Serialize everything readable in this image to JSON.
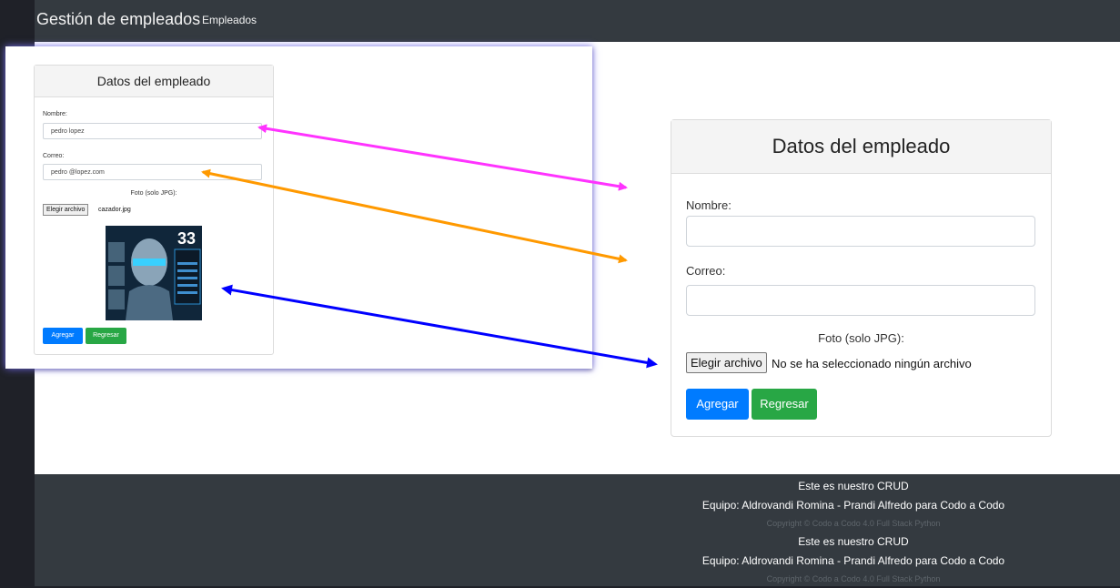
{
  "navbar": {
    "brand": "Gestión de empleados",
    "link": "Empleados"
  },
  "small_form": {
    "title": "Datos del empleado",
    "nombre_label": "Nombre:",
    "nombre_value": "pedro lopez",
    "correo_label": "Correo:",
    "correo_value": "pedro @lopez.com",
    "foto_label": "Foto (solo JPG):",
    "file_button": "Elegir archivo",
    "file_name": "cazador.jpg",
    "image_text": "33",
    "agregar": "Agregar",
    "regresar": "Regresar"
  },
  "big_form": {
    "title": "Datos del empleado",
    "nombre_label": "Nombre:",
    "nombre_value": "",
    "correo_label": "Correo:",
    "correo_value": "",
    "foto_label": "Foto (solo JPG):",
    "file_button": "Elegir archivo",
    "file_name": "No se ha seleccionado ningún archivo",
    "agregar": "Agregar",
    "regresar": "Regresar"
  },
  "footer": {
    "line1": "Este es nuestro CRUD",
    "line2": "Equipo: Aldrovandi Romina - Prandi Alfredo para Codo a Codo",
    "copyright": "Copyright © Codo a Codo 4.0 Full Stack Python"
  },
  "colors": {
    "navbar_bg": "#343a40",
    "agregar_btn": "#007bff",
    "regresar_btn": "#28a745",
    "arrow_nombre": "#ff33ff",
    "arrow_correo": "#ff9900",
    "arrow_foto": "#0000ff"
  }
}
